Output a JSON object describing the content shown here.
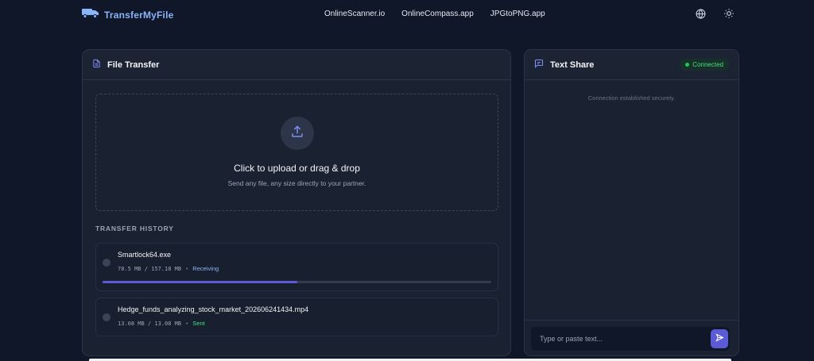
{
  "brand": {
    "name": "TransferMyFile",
    "icon": "truck-icon",
    "color": "#8ab4f8"
  },
  "nav": {
    "links": [
      "OnlineScanner.io",
      "OnlineCompass.app",
      "JPGtoPNG.app"
    ]
  },
  "header_icons": [
    "globe-icon",
    "sun-icon"
  ],
  "file_transfer": {
    "title": "File Transfer",
    "icon": "file-icon",
    "dropzone": {
      "title": "Click to upload or drag & drop",
      "subtitle": "Send any file, any size directly to your partner.",
      "icon": "upload-icon"
    },
    "history_label": "TRANSFER HISTORY",
    "items": [
      {
        "name": "Smartlock64.exe",
        "size": "78.5 MB / 157.18 MB",
        "separator": "•",
        "status": "Receiving",
        "progress": 0.5
      },
      {
        "name": "Hedge_funds_analyzing_stock_market_202606241434.mp4",
        "size": "13.08 MB / 13.08 MB",
        "separator": "•",
        "status": "Sent",
        "progress": 1.0
      }
    ]
  },
  "text_share": {
    "title": "Text Share",
    "icon": "chat-icon",
    "badge": "Connected",
    "connection_message": "Connection established securely.",
    "input": {
      "placeholder": "Type or paste text...",
      "value": ""
    },
    "send_icon": "send-icon"
  },
  "colors": {
    "accent": "#5b5bd6",
    "connected": "#4ade80",
    "receiving": "#8ab4f8",
    "background": "#0f1729",
    "card": "#1a2232"
  }
}
